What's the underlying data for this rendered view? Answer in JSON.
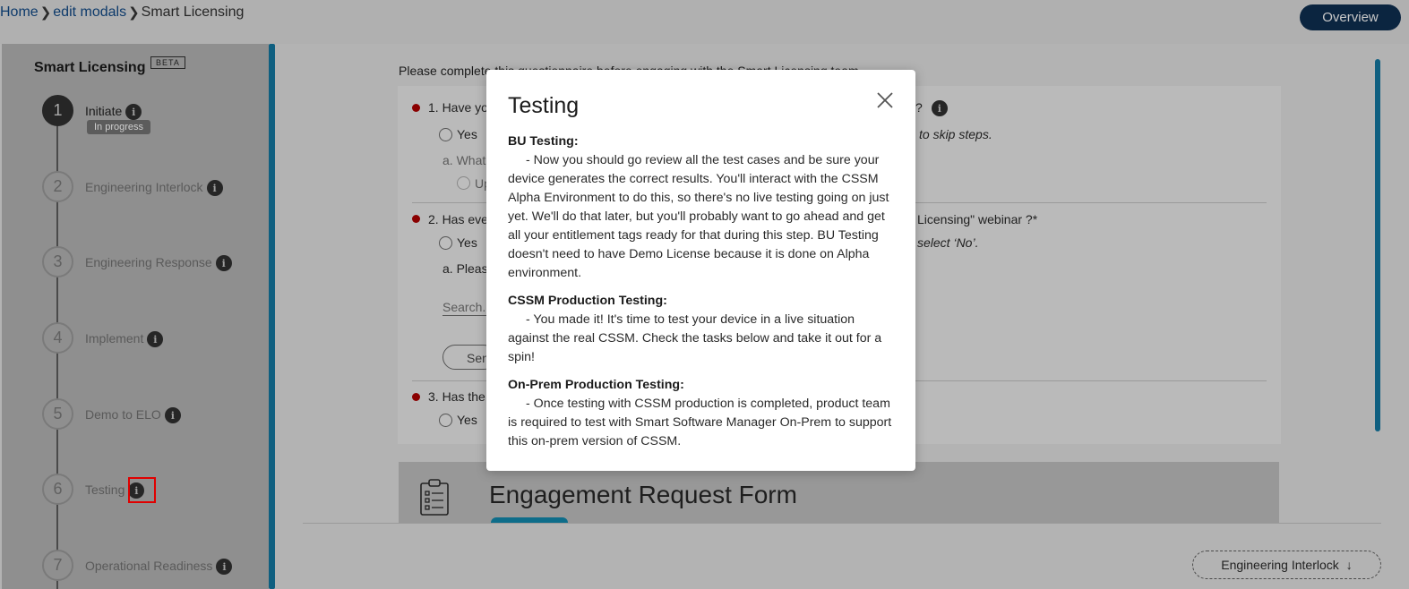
{
  "breadcrumb": {
    "home": "Home",
    "edit_modals": "edit modals",
    "current": "Smart Licensing",
    "separator": ">"
  },
  "header": {
    "overview_label": "Overview"
  },
  "sidebar": {
    "title": "Smart Licensing",
    "beta_label": "BETA",
    "in_progress_label": "In progress",
    "steps": [
      {
        "num": "1",
        "label": "Initiate"
      },
      {
        "num": "2",
        "label": "Engineering Interlock"
      },
      {
        "num": "3",
        "label": "Engineering Response"
      },
      {
        "num": "4",
        "label": "Implement"
      },
      {
        "num": "5",
        "label": "Demo to ELO"
      },
      {
        "num": "6",
        "label": "Testing"
      },
      {
        "num": "7",
        "label": "Operational Readiness"
      }
    ]
  },
  "questionnaire": {
    "intro": "Please complete this questionnaire before engaging with the Smart Licensing team",
    "q1_text": "1. Have yo",
    "q1_tail": "?",
    "q1_yes": "Yes",
    "q1_hint": "to skip steps.",
    "q1_sub": "a. What",
    "q1_sub_opt": "Up",
    "q2_text": "2. Has eve",
    "q2_tail": "Licensing\" webinar ?*",
    "q2_yes": "Yes",
    "q2_hint": "select ‘No’.",
    "q2_sub": "a. Pleas",
    "search_placeholder": "Search...",
    "send_label": "Sen",
    "q3_text": "3. Has the",
    "q3_yes": "Yes"
  },
  "engagement_form": {
    "title": "Engagement Request Form"
  },
  "footer": {
    "next_step_label": "Engineering Interlock",
    "next_arrow": "↓"
  },
  "modal": {
    "title": "Testing",
    "sections": [
      {
        "heading": "BU Testing:",
        "body": "- Now you should go review all the test cases and be sure your device generates the correct results. You'll interact with the CSSM Alpha Environment to do this, so there's no live testing going on just yet. We'll do that later, but you'll probably want to go ahead and get all your entitlement tags ready for that during this step. BU Testing doesn't need to have Demo License because it is done on Alpha environment."
      },
      {
        "heading": "CSSM Production Testing:",
        "body": "- You made it! It's time to test your device in a live situation against the real CSSM. Check the tasks below and take it out for a spin!"
      },
      {
        "heading": "On-Prem Production Testing:",
        "body": "- Once testing with CSSM production is completed, product team is required to test with Smart Software Manager On-Prem to support this on-prem version of CSSM."
      }
    ]
  },
  "colors": {
    "accent_teal": "#0f5f80",
    "overview_bg": "#0b2540",
    "highlight": "#e00000",
    "required_dot": "#8a0000"
  }
}
